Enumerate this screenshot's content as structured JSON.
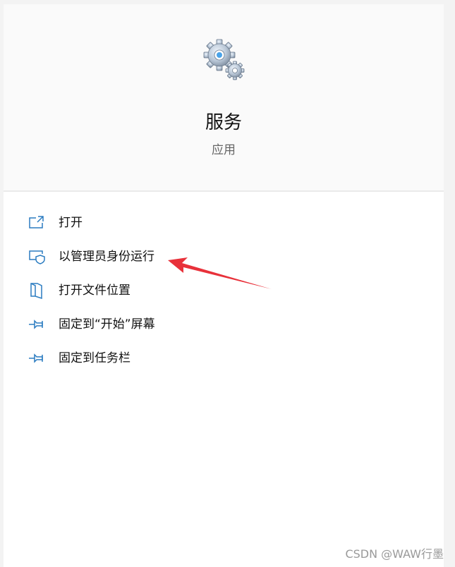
{
  "app": {
    "name": "服务",
    "type": "应用",
    "icon": "gears-icon"
  },
  "menu": {
    "items": [
      {
        "label": "打开",
        "icon": "open-window-icon"
      },
      {
        "label": "以管理员身份运行",
        "icon": "shield-monitor-icon"
      },
      {
        "label": "打开文件位置",
        "icon": "folder-location-icon"
      },
      {
        "label": "固定到“开始”屏幕",
        "icon": "pin-icon"
      },
      {
        "label": "固定到任务栏",
        "icon": "pin-icon"
      }
    ]
  },
  "annotation": {
    "arrow_color": "#e8313a"
  },
  "watermark": {
    "text": "CSDN @WAW行墨"
  },
  "colors": {
    "icon_blue": "#2b7cc1",
    "header_bg": "#fafafa",
    "text": "#111111",
    "subtext": "#666666"
  }
}
